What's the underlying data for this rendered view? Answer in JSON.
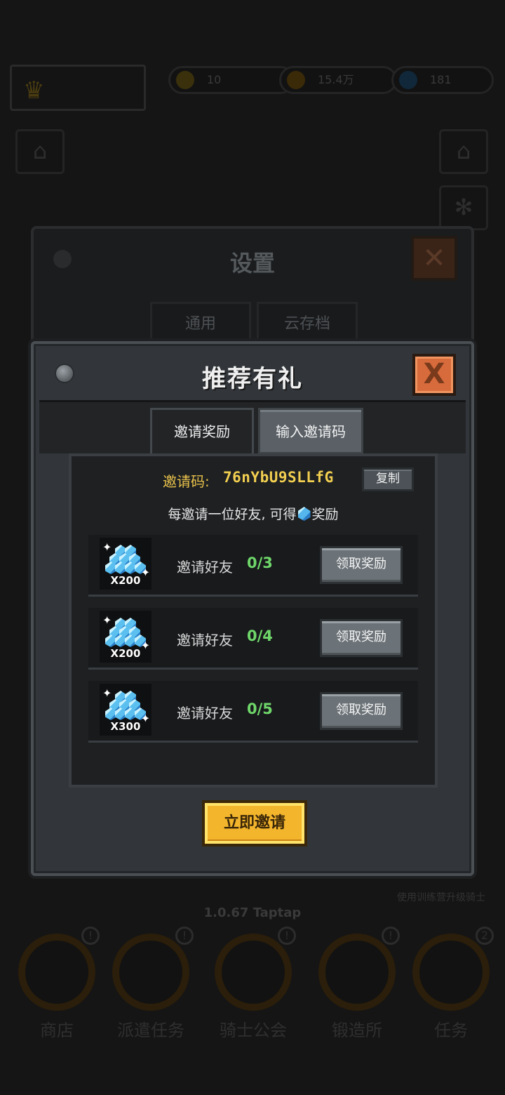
{
  "background": {
    "res_a_value": "10",
    "res_b_value": "15.4万",
    "res_c_value": "181",
    "settings_title": "设置",
    "settings_tabs": [
      "通用",
      "云存档"
    ],
    "version": "1.0.67 Taptap",
    "hint": "使用训练营升级骑士",
    "nav": [
      {
        "label": "商店",
        "badge": "!"
      },
      {
        "label": "派遣任务",
        "badge": "!"
      },
      {
        "label": "骑士公会",
        "badge": "!"
      },
      {
        "label": "锻造所",
        "badge": "!"
      },
      {
        "label": "任务",
        "badge": "2"
      }
    ]
  },
  "dialog": {
    "title": "推荐有礼",
    "close_label": "X",
    "tabs": [
      {
        "label": "邀请奖励",
        "active": true
      },
      {
        "label": "输入邀请码",
        "active": false
      }
    ],
    "invite_code_label": "邀请码:",
    "invite_code": "76nYbU9SLLfG",
    "copy_label": "复制",
    "description_prefix": "每邀请一位好友, 可得",
    "description_suffix": "奖励",
    "rewards": [
      {
        "icon": "gem-icon",
        "quantity": "X200",
        "label": "邀请好友",
        "progress": "0/3",
        "button": "领取奖励"
      },
      {
        "icon": "gem-icon",
        "quantity": "X200",
        "label": "邀请好友",
        "progress": "0/4",
        "button": "领取奖励"
      },
      {
        "icon": "gem-icon",
        "quantity": "X300",
        "label": "邀请好友",
        "progress": "0/5",
        "button": "领取奖励"
      }
    ],
    "invite_now": "立即邀请"
  },
  "colors": {
    "accent_gold": "#f2b52c",
    "code_yellow": "#f2cf50",
    "progress_green": "#6fd76a",
    "close_orange": "#d86b3c"
  }
}
